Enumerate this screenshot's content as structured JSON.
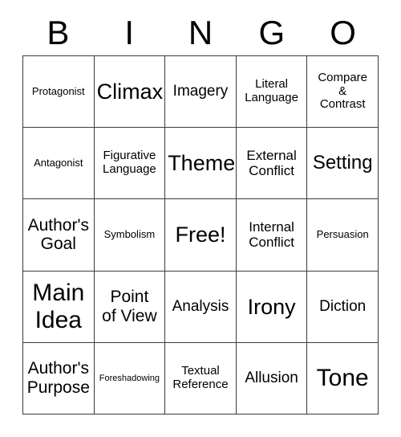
{
  "card": {
    "title": "BINGO",
    "header_letters": [
      "B",
      "I",
      "N",
      "G",
      "O"
    ],
    "free_space_label": "Free!",
    "colors": {
      "background": "#ffffff",
      "text": "#000000",
      "grid_line": "#3b3b3b"
    },
    "grid": {
      "columns": 5,
      "rows": 5,
      "cells": [
        {
          "text": "Protagonist",
          "size": "xs"
        },
        {
          "text": "Climax",
          "size": "xxl"
        },
        {
          "text": "Imagery",
          "size": "ml"
        },
        {
          "text": "Literal\nLanguage",
          "size": "s"
        },
        {
          "text": "Compare\n&\nContrast",
          "size": "s"
        },
        {
          "text": "Antagonist",
          "size": "xs"
        },
        {
          "text": "Figurative\nLanguage",
          "size": "s"
        },
        {
          "text": "Theme",
          "size": "xxl"
        },
        {
          "text": "External\nConflict",
          "size": "m"
        },
        {
          "text": "Setting",
          "size": "xl"
        },
        {
          "text": "Author's\nGoal",
          "size": "l"
        },
        {
          "text": "Symbolism",
          "size": "xs"
        },
        {
          "text": "Free!",
          "size": "xxl"
        },
        {
          "text": "Internal\nConflict",
          "size": "m"
        },
        {
          "text": "Persuasion",
          "size": "xs"
        },
        {
          "text": "Main\nIdea",
          "size": "huge"
        },
        {
          "text": "Point\nof View",
          "size": "l"
        },
        {
          "text": "Analysis",
          "size": "ml"
        },
        {
          "text": "Irony",
          "size": "xxl"
        },
        {
          "text": "Diction",
          "size": "ml"
        },
        {
          "text": "Author's\nPurpose",
          "size": "l"
        },
        {
          "text": "Foreshadowing",
          "size": "xxs"
        },
        {
          "text": "Textual\nReference",
          "size": "s"
        },
        {
          "text": "Allusion",
          "size": "ml"
        },
        {
          "text": "Tone",
          "size": "huge"
        }
      ]
    }
  }
}
